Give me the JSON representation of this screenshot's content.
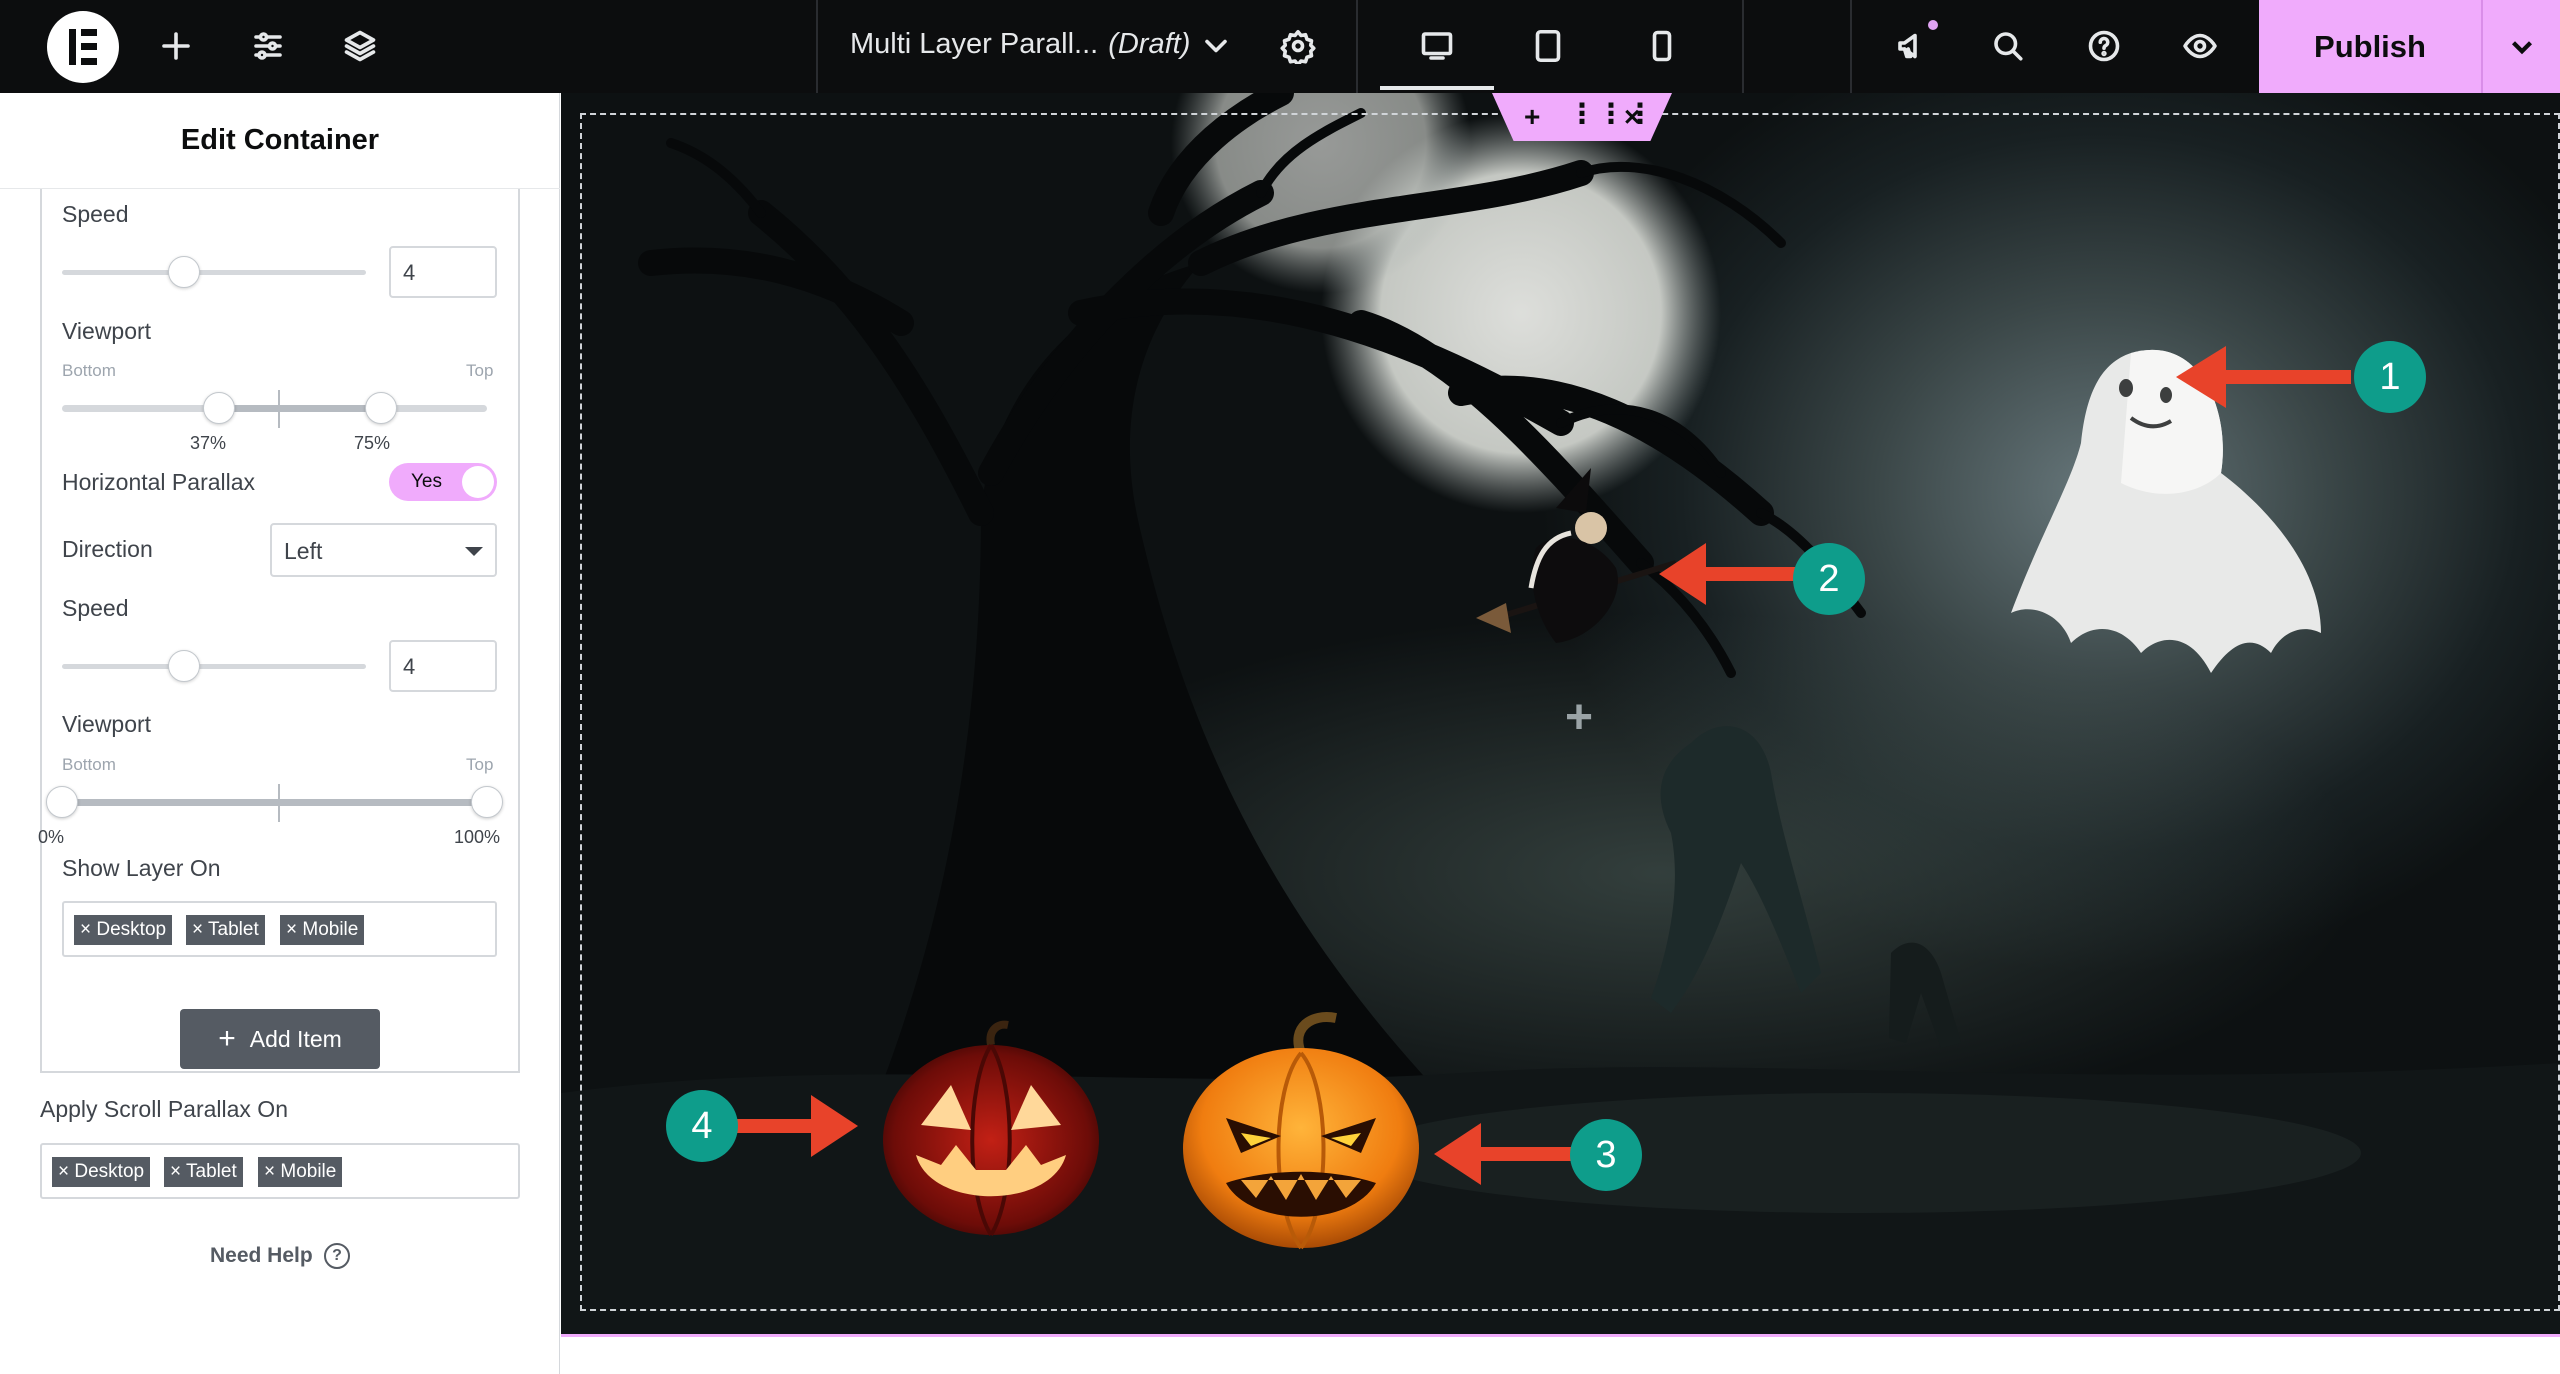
{
  "topbar": {
    "document_title": "Multi Layer Parall...",
    "document_status": "(Draft)",
    "publish_label": "Publish",
    "icons": [
      "elementor-logo-icon",
      "add-icon",
      "settings-sliders-icon",
      "layers-icon",
      "chevron-down-icon",
      "gear-icon",
      "desktop-icon",
      "tablet-icon",
      "mobile-icon",
      "megaphone-icon",
      "search-icon",
      "help-icon",
      "eye-icon",
      "chevron-down-icon"
    ]
  },
  "panel": {
    "title": "Edit Container",
    "vertical": {
      "speed_label": "Speed",
      "speed_value": "4",
      "viewport_label": "Viewport",
      "viewport_bottom_label": "Bottom",
      "viewport_top_label": "Top",
      "viewport_start": "37%",
      "viewport_end": "75%",
      "speed_slider_fraction": 0.4,
      "viewport_start_fraction": 0.37,
      "viewport_end_fraction": 0.75
    },
    "horizontal_parallax_label": "Horizontal Parallax",
    "horizontal_parallax_value": "Yes",
    "direction_label": "Direction",
    "direction_value": "Left",
    "horizontal": {
      "speed_label": "Speed",
      "speed_value": "4",
      "viewport_label": "Viewport",
      "viewport_bottom_label": "Bottom",
      "viewport_top_label": "Top",
      "viewport_start": "0%",
      "viewport_end": "100%",
      "speed_slider_fraction": 0.4,
      "viewport_start_fraction": 0.0,
      "viewport_end_fraction": 1.0
    },
    "show_layer_on_label": "Show Layer On",
    "show_layer_on_tags": [
      "× Desktop",
      "× Tablet",
      "× Mobile"
    ],
    "add_item_label": "Add Item",
    "apply_scroll_parallax_label": "Apply Scroll Parallax On",
    "apply_scroll_parallax_tags": [
      "× Desktop",
      "× Tablet",
      "× Mobile"
    ],
    "need_help_label": "Need Help"
  },
  "canvas": {
    "badges": [
      "1",
      "2",
      "3",
      "4"
    ],
    "layers": [
      "ghost",
      "witch",
      "angry-pumpkin",
      "jack-o-lantern"
    ]
  },
  "colors": {
    "accent": "#f0abfc",
    "badge": "#0e9d8b",
    "arrow": "#e8432a",
    "topbar": "#0c0d0e"
  }
}
